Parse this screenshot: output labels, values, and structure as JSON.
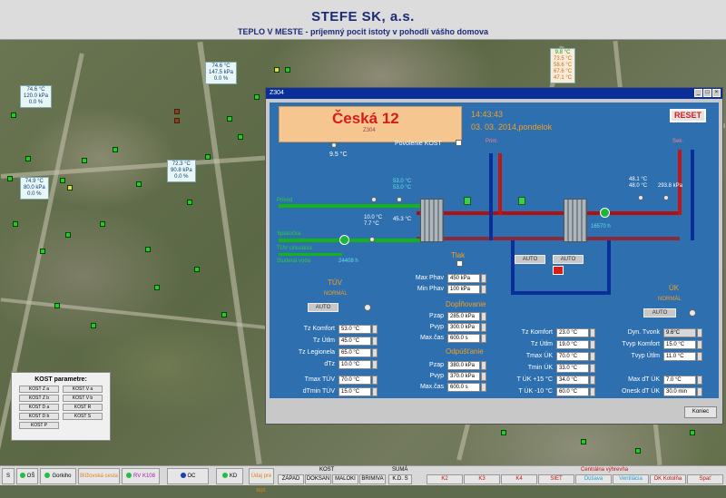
{
  "header": {
    "company": "STEFE SK, a.s.",
    "slogan": "TEPLO V MESTE - príjemný pocit istoty v pohodlí vášho domova"
  },
  "map_labels": [
    {
      "lines": [
        "74.6 °C",
        "120.0 kPa",
        "0.0 %"
      ]
    },
    {
      "lines": [
        "74.6 °C",
        "147.5 kPa",
        "0.0 %"
      ]
    },
    {
      "lines": [
        "72.3 °C",
        "90.8 kPa",
        "0.0 %"
      ]
    },
    {
      "lines": [
        "74.9 °C",
        "80.0 kPa",
        "0.0 %"
      ]
    },
    {
      "lines": [
        "9.8 °C",
        "73.5 °C",
        "58.6 °C",
        "67.6 °C",
        "47.1 °C"
      ]
    }
  ],
  "window": {
    "title": "Z304",
    "buttons": [
      "_",
      "□",
      "×"
    ]
  },
  "panel": {
    "name": "Česká 12",
    "code": "Z304",
    "time": "14:43:43",
    "date": "03. 03. 2014,pondelok",
    "reset": "RESET",
    "povolenie_kost": "Povolenie KOST",
    "close": "Koniec",
    "outdoor_temp": "9.5 °C",
    "flow_labels": [
      "Prívod",
      "Spiatočka",
      "TUV cirkulácia",
      "Studená voda"
    ],
    "readings": {
      "t_53a": "53.0 °C",
      "t_53b": "53.0 °C",
      "t_10": "10.0 °C",
      "t_77": "7.7 °C",
      "t_453": "45.3 °C",
      "counter1": "24408 h",
      "counter2": "16570 h",
      "t_481": "48.1 °C",
      "t_480": "48.0 °C",
      "p_2938": "293.8 kPa",
      "prim": "Prim.",
      "sek": "Sek."
    },
    "tlak": "Tlak",
    "auto": "AUTO",
    "tuv": {
      "title": "TÚV",
      "status": "NORMÁL",
      "mode": "AUTO",
      "rows": [
        {
          "label": "Tz Komfort",
          "value": "53.0 °C"
        },
        {
          "label": "Tz Útlm",
          "value": "45.0 °C"
        },
        {
          "label": "Tz Legionela",
          "value": "65.0 °C"
        },
        {
          "label": "dTz",
          "value": "10.0 °C"
        },
        {
          "label": "Tmax TÚV",
          "value": "70.0 °C"
        },
        {
          "label": "dTmin TÚV",
          "value": "15.0 °C"
        }
      ]
    },
    "phav": [
      {
        "label": "Max Phav",
        "value": "450 kPa"
      },
      {
        "label": "Min Phav",
        "value": "100 kPa"
      }
    ],
    "dopln1": {
      "title": "Dopĺňovanie",
      "rows": [
        {
          "label": "Pzap",
          "value": "285.0 kPa"
        },
        {
          "label": "Pvyp",
          "value": "300.0 kPa"
        },
        {
          "label": "Max.čas",
          "value": "600.0 s"
        }
      ]
    },
    "dopln2": {
      "title": "Odpúšťanie",
      "rows": [
        {
          "label": "Pzap",
          "value": "380.0 kPa"
        },
        {
          "label": "Pvyp",
          "value": "370.0 kPa"
        },
        {
          "label": "Max.čas",
          "value": "600.0 s"
        }
      ]
    },
    "uk_rows": [
      {
        "label": "Tz Komfort",
        "value": "23.0 °C"
      },
      {
        "label": "Tz Útlm",
        "value": "19.0 °C"
      },
      {
        "label": "Tmax ÚK",
        "value": "70.0 °C"
      },
      {
        "label": "Tmin ÚK",
        "value": "33.0 °C"
      },
      {
        "label": "T ÚK +15 °C",
        "value": "34.0 °C"
      },
      {
        "label": "T ÚK -10 °C",
        "value": "60.0 °C"
      }
    ],
    "uk": {
      "title": "ÚK",
      "status": "NORMÁL",
      "mode": "AUTO",
      "rows": [
        {
          "label": "Dyn. Tvonk",
          "value": "9.6°C"
        },
        {
          "label": "Tvyp Komfort",
          "value": "15.0 °C"
        },
        {
          "label": "Tvyp Útlm",
          "value": "11.0 °C"
        },
        {
          "label": "Max dT ÚK",
          "value": "7.0 °C"
        },
        {
          "label": "Onesk dT ÚK",
          "value": "30.0 min"
        }
      ]
    }
  },
  "kost": {
    "title": "KOST parametre:",
    "buttons": [
      "KOST Z a",
      "KOST V a",
      "KOST Z b",
      "KOST V b",
      "KOST D a",
      "KOST R",
      "KOST D b",
      "KOST S",
      "KOST P"
    ]
  },
  "bottom": {
    "items": [
      "S",
      "OŠ",
      "Gorkiho",
      "Blížovská cesta",
      "RV K108",
      "OC",
      "KD",
      "Údaj pre tepl."
    ],
    "group1_title": "KOST",
    "group1": [
      "ZÁPAD",
      "DOKSAN",
      "MALOKI",
      "BRIMIVA"
    ],
    "group2_title": "SUMÁ",
    "group2": [
      "K.D. S"
    ],
    "central_title": "Centrálna výhrevňa",
    "central": [
      "K2",
      "K3",
      "K4",
      "SIET",
      "Dúšava",
      "Ventilácia",
      "DK Kotolňa",
      "Spať"
    ]
  }
}
